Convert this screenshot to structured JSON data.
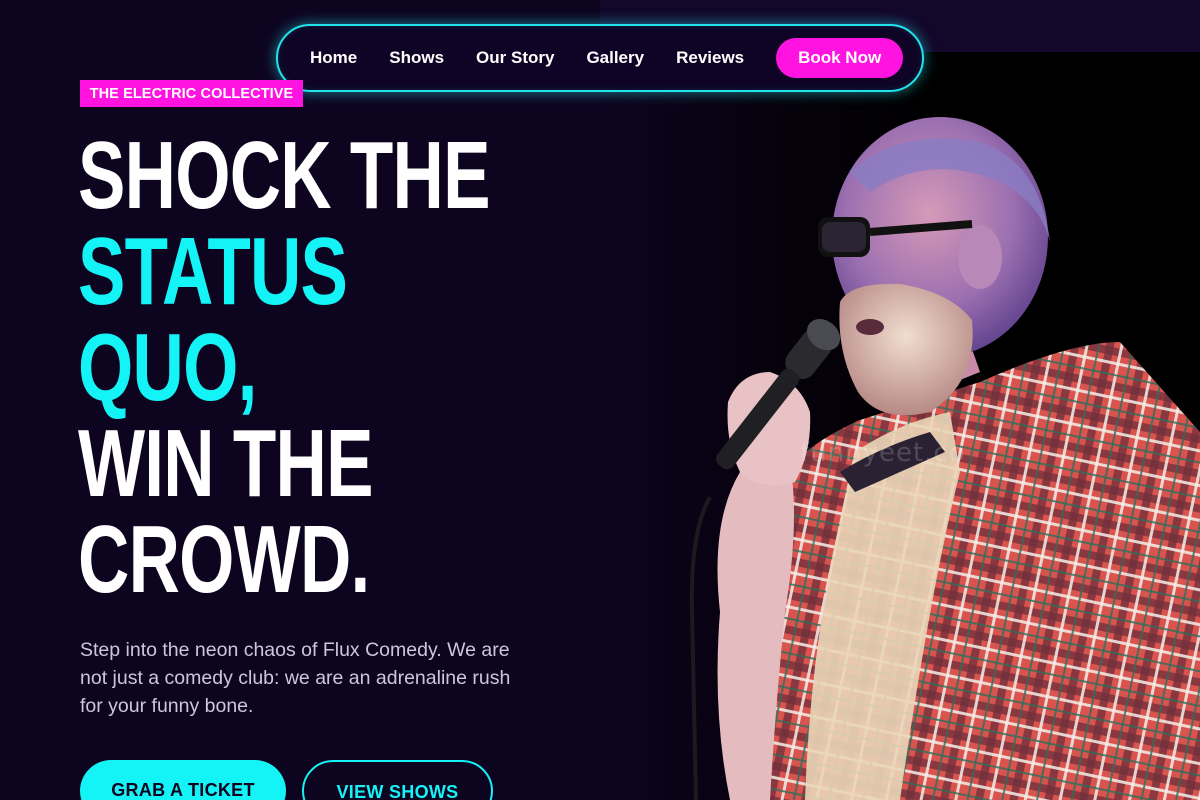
{
  "nav": {
    "links": [
      "Home",
      "Shows",
      "Our Story",
      "Gallery",
      "Reviews"
    ],
    "cta": "Book Now"
  },
  "hero": {
    "badge": "THE ELECTRIC COLLECTIVE",
    "headline": {
      "line1": "SHOCK THE",
      "line2": "STATUS",
      "line3": "QUO,",
      "line4": "WIN THE",
      "line5": "CROWD."
    },
    "intro": "Step into the neon chaos of Flux Comedy. We are not just a comedy club: we are an adrenaline rush for your funny bone.",
    "primary_button": "GRAB A TICKET",
    "secondary_button": "VIEW SHOWS"
  },
  "photo": {
    "watermark": "funnyeet.co"
  },
  "colors": {
    "background": "#0d0420",
    "accent_pink": "#ff13e0",
    "accent_cyan": "#14f3f5"
  }
}
